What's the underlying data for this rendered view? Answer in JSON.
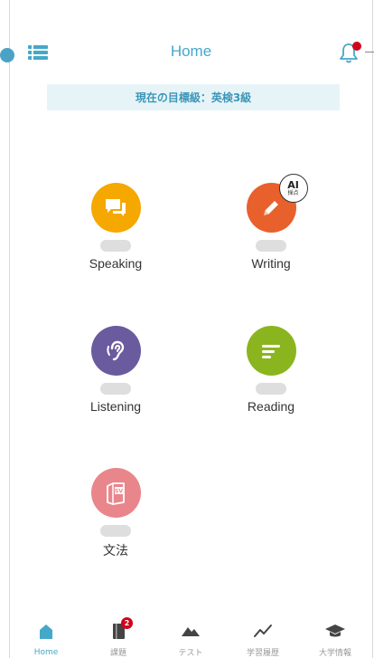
{
  "header": {
    "title": "Home",
    "menu_icon": "menu-icon",
    "bell_icon": "bell-icon",
    "bell_has_notification": true
  },
  "goal_banner": {
    "text": "現在の目標級：英検3級"
  },
  "skills": [
    {
      "label": "Speaking",
      "icon": "chat-bubbles-icon",
      "color": "#f5a800"
    },
    {
      "label": "Writing",
      "icon": "pencil-icon",
      "color": "#e8602c",
      "badge": {
        "text": "AI",
        "sub": "採点"
      }
    },
    {
      "label": "Listening",
      "icon": "ear-icon",
      "color": "#6a5a9e"
    },
    {
      "label": "Reading",
      "icon": "text-lines-icon",
      "color": "#8ab51e"
    },
    {
      "label": "文法",
      "icon": "sv-book-icon",
      "color": "#e8868c",
      "icon_text": "SV"
    }
  ],
  "tabbar": {
    "tabs": [
      {
        "label": "Home",
        "icon": "home-icon",
        "active": true
      },
      {
        "label": "課題",
        "icon": "assignment-icon",
        "badge": "2"
      },
      {
        "label": "テスト",
        "icon": "mountain-icon"
      },
      {
        "label": "学習履歴",
        "icon": "line-chart-icon"
      },
      {
        "label": "大学情報",
        "icon": "graduation-cap-icon"
      }
    ]
  },
  "colors": {
    "accent": "#45a8c9",
    "banner_bg": "#e6f4f8",
    "notification": "#d0021b",
    "inactive": "#999999"
  }
}
